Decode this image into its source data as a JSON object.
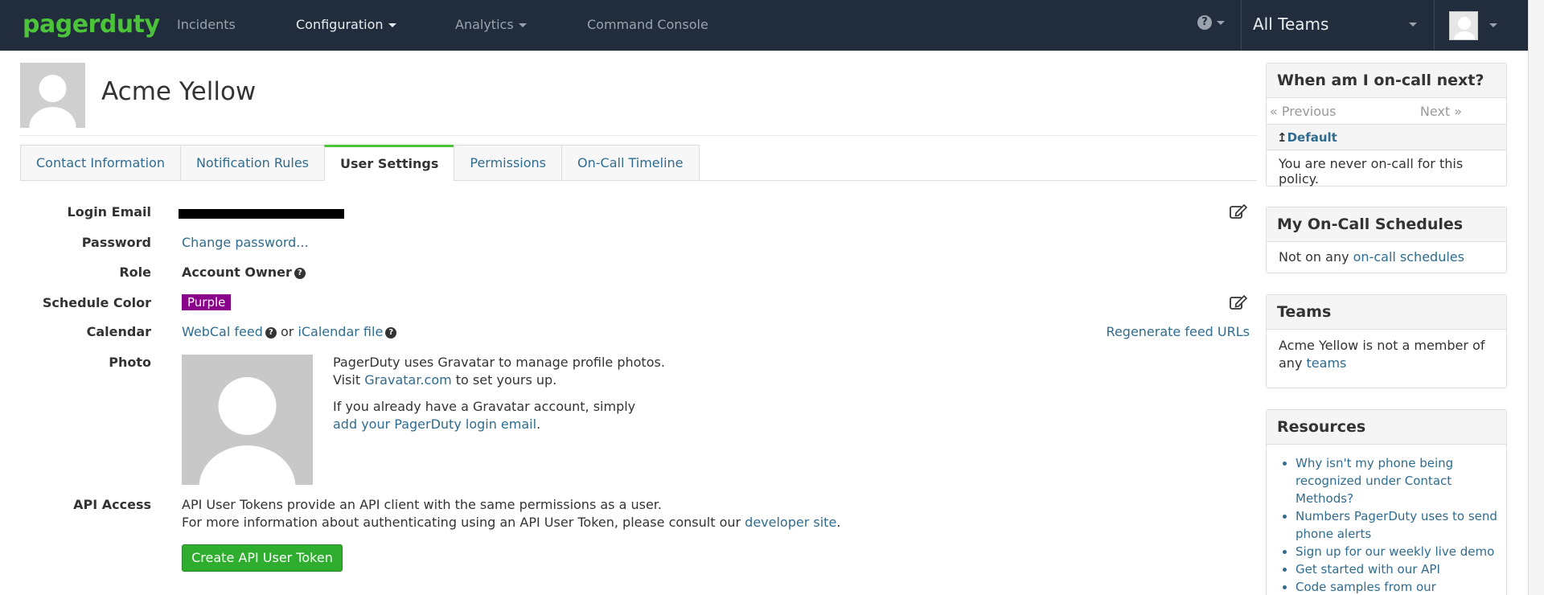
{
  "nav": {
    "logo": "pagerduty",
    "items": [
      "Incidents",
      "Configuration",
      "Analytics",
      "Command Console"
    ],
    "team_selector": "All Teams"
  },
  "profile": {
    "name": "Acme Yellow"
  },
  "tabs": [
    "Contact Information",
    "Notification Rules",
    "User Settings",
    "Permissions",
    "On-Call Timeline"
  ],
  "settings": {
    "login_email_label": "Login Email",
    "password_label": "Password",
    "password_link": "Change password...",
    "role_label": "Role",
    "role_value": "Account Owner",
    "schedule_color_label": "Schedule Color",
    "schedule_color_value": "Purple",
    "schedule_color_hex": "#8b008b",
    "calendar_label": "Calendar",
    "webcal_link": "WebCal feed",
    "calendar_or": "or",
    "icalendar_link": "iCalendar file",
    "regenerate_link": "Regenerate feed URLs",
    "photo_label": "Photo",
    "photo_text_1": "PagerDuty uses Gravatar to manage profile photos.",
    "photo_text_2_pre": "Visit",
    "photo_text_2_link": "Gravatar.com",
    "photo_text_2_post": "to set yours up.",
    "photo_text_3": "If you already have a Gravatar account, simply",
    "photo_text_4_link": "add your PagerDuty login email",
    "photo_text_4_post": ".",
    "api_label": "API Access",
    "api_text_1": "API User Tokens provide an API client with the same permissions as a user.",
    "api_text_2_pre": "For more information about authenticating using an API User Token, please consult our",
    "api_text_2_link": "developer site",
    "api_text_2_post": ".",
    "api_button": "Create API User Token"
  },
  "panels": {
    "oncall": {
      "title": "When am I on-call next?",
      "previous": "« Previous",
      "next": "Next »",
      "policy": "Default",
      "text": "You are never on-call for this policy."
    },
    "schedules": {
      "title": "My On-Call Schedules",
      "text_pre": "Not on any",
      "link": "on-call schedules"
    },
    "teams": {
      "title": "Teams",
      "text_pre": "Acme Yellow is not a member of any",
      "link": "teams"
    },
    "resources": {
      "title": "Resources",
      "items": [
        "Why isn't my phone being recognized under Contact Methods?",
        "Numbers PagerDuty uses to send phone alerts",
        "Sign up for our weekly live demo",
        "Get started with our API",
        "Code samples from our"
      ]
    }
  },
  "colors": {
    "navbar": "#212d3c",
    "brand_green": "#4cc43a",
    "link": "#2f6c8f",
    "button_green": "#2fad2f"
  }
}
